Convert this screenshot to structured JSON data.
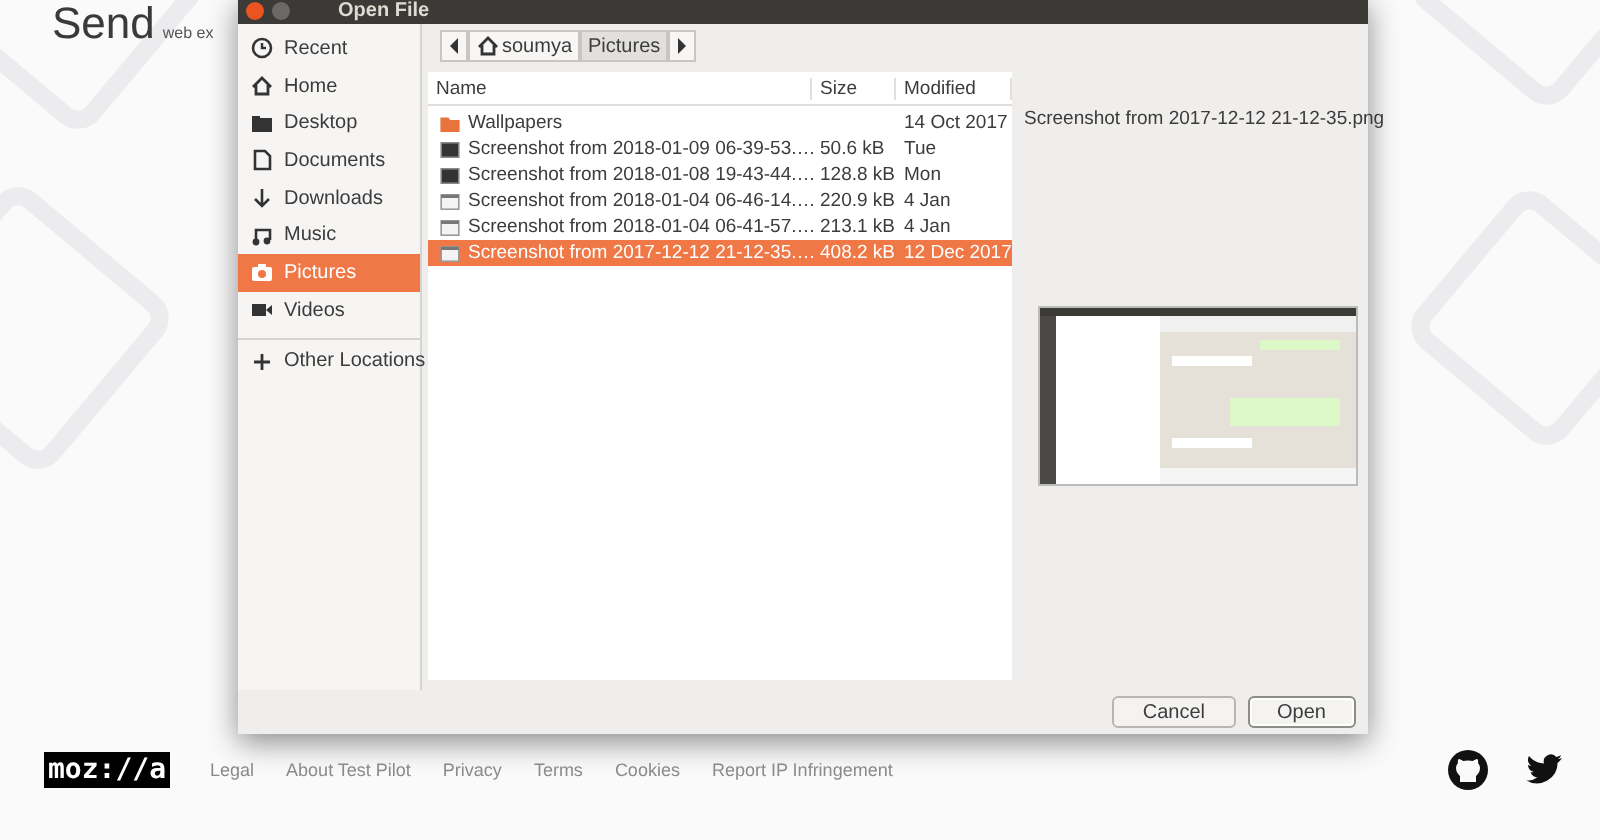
{
  "page": {
    "logo": "Send",
    "tagline": "web ex"
  },
  "dialog": {
    "title": "Open File",
    "path": [
      {
        "label": "soumya",
        "kind": "home",
        "selected": false
      },
      {
        "label": "Pictures",
        "kind": "folder",
        "selected": true
      }
    ],
    "places": [
      {
        "label": "Recent",
        "kind": "recent",
        "selected": false
      },
      {
        "label": "Home",
        "kind": "home",
        "selected": false
      },
      {
        "label": "Desktop",
        "kind": "desktop",
        "selected": false
      },
      {
        "label": "Documents",
        "kind": "document",
        "selected": false
      },
      {
        "label": "Downloads",
        "kind": "download",
        "selected": false
      },
      {
        "label": "Music",
        "kind": "music",
        "selected": false
      },
      {
        "label": "Pictures",
        "kind": "camera",
        "selected": true
      },
      {
        "label": "Videos",
        "kind": "video",
        "selected": false
      },
      {
        "label": "Other Locations",
        "kind": "plus",
        "selected": false
      }
    ],
    "columns": [
      "Name",
      "Size",
      "Modified"
    ],
    "files": [
      {
        "name": "Wallpapers",
        "kind": "folder",
        "modified": "14 Oct 2017",
        "selected": false
      },
      {
        "name": "Screenshot from 2018-01-09 06-39-53.…",
        "kind": "dark",
        "size": "50.6 kB",
        "modified": "Tue",
        "selected": false
      },
      {
        "name": "Screenshot from 2018-01-08 19-43-44.…",
        "kind": "dark",
        "size": "128.8 kB",
        "modified": "Mon",
        "selected": false
      },
      {
        "name": "Screenshot from 2018-01-04 06-46-14.…",
        "kind": "light",
        "size": "220.9 kB",
        "modified": "4 Jan",
        "selected": false
      },
      {
        "name": "Screenshot from 2018-01-04 06-41-57.…",
        "kind": "light",
        "size": "213.1 kB",
        "modified": "4 Jan",
        "selected": false
      },
      {
        "name": "Screenshot from 2017-12-12 21-12-35.…",
        "kind": "light",
        "size": "408.2 kB",
        "modified": "12 Dec 2017",
        "selected": true
      }
    ],
    "preview_title": "Screenshot from 2017-12-12 21-12-35.png",
    "buttons": [
      {
        "label": "Cancel",
        "kind": "cancel"
      },
      {
        "label": "Open",
        "kind": "open"
      }
    ]
  },
  "footer": {
    "logo": "moz://a",
    "links": [
      "Legal",
      "About Test Pilot",
      "Privacy",
      "Terms",
      "Cookies",
      "Report IP Infringement"
    ]
  }
}
